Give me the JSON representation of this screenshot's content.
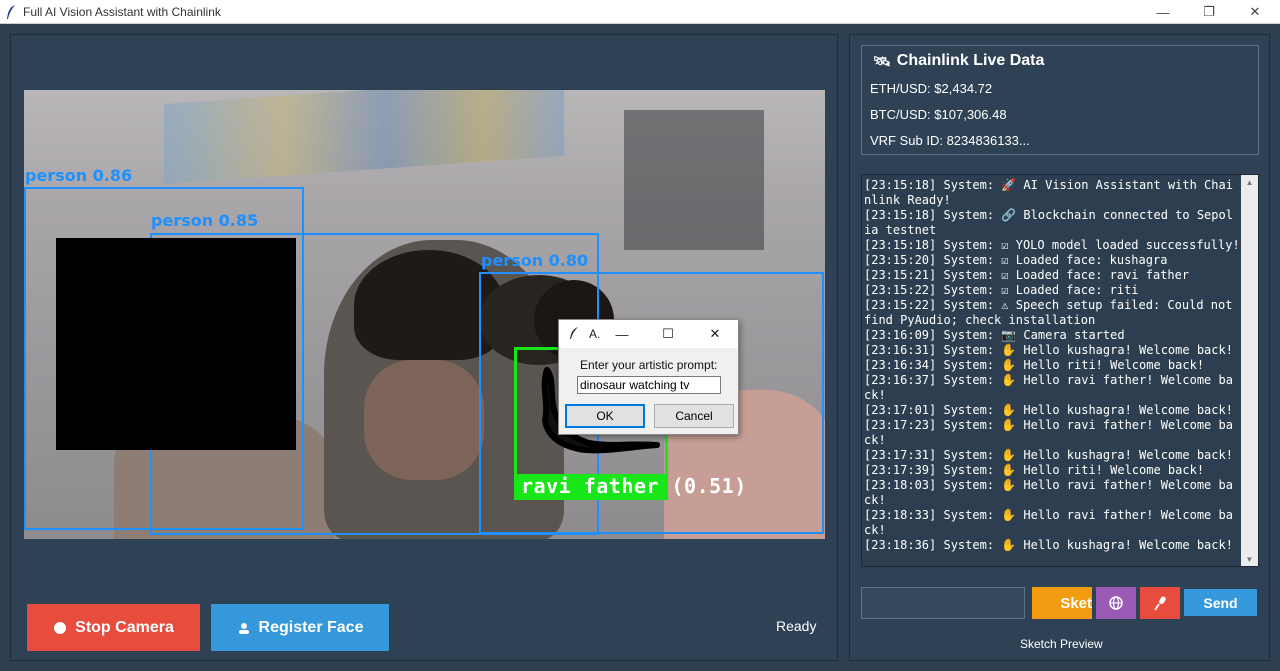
{
  "window": {
    "title": "Full AI Vision Assistant with Chainlink",
    "minimize": "—",
    "maximize": "❐",
    "close": "✕"
  },
  "video": {
    "detections": [
      {
        "label": "person 0.86"
      },
      {
        "label": "person 0.85"
      },
      {
        "label": "person 0.80"
      }
    ],
    "face_label": "ravi father (0.51)"
  },
  "dialog": {
    "title": "A.",
    "minimize": "—",
    "maximize": "☐",
    "close": "✕",
    "prompt_label": "Enter your artistic prompt:",
    "input_value": "dinosaur watching tv",
    "ok_label": "OK",
    "cancel_label": "Cancel"
  },
  "controls": {
    "stop_camera_label": "Stop Camera",
    "register_face_label": "Register Face",
    "status": "Ready"
  },
  "chainlink": {
    "title": "Chainlink Live Data",
    "eth_usd": "ETH/USD: $2,434.72",
    "btc_usd": "BTC/USD: $107,306.48",
    "vrf_sub": "VRF Sub ID: 8234836133..."
  },
  "log": {
    "text": "[23:15:18] System: 🚀 AI Vision Assistant with Chainlink Ready!\n[23:15:18] System: 🔗 Blockchain connected to Sepolia testnet\n[23:15:18] System: ☑ YOLO model loaded successfully!\n[23:15:20] System: ☑ Loaded face: kushagra\n[23:15:21] System: ☑ Loaded face: ravi father\n[23:15:22] System: ☑ Loaded face: riti\n[23:15:22] System: ⚠ Speech setup failed: Could not find PyAudio; check installation\n[23:16:09] System: 📷 Camera started\n[23:16:31] System: ✋ Hello kushagra! Welcome back!\n[23:16:34] System: ✋ Hello riti! Welcome back!\n[23:16:37] System: ✋ Hello ravi father! Welcome back!\n[23:17:01] System: ✋ Hello kushagra! Welcome back!\n[23:17:23] System: ✋ Hello ravi father! Welcome back!\n[23:17:31] System: ✋ Hello kushagra! Welcome back!\n[23:17:39] System: ✋ Hello riti! Welcome back!\n[23:18:03] System: ✋ Hello ravi father! Welcome back!\n[23:18:33] System: ✋ Hello ravi father! Welcome back!\n[23:18:36] System: ✋ Hello kushagra! Welcome back!"
  },
  "chat": {
    "input_value": "",
    "sketch_label": "Sket",
    "send_label": "Send",
    "sketch_preview_label": "Sketch Preview"
  },
  "colors": {
    "background": "#2c3e50",
    "stop": "#e74c3c",
    "register": "#3498db",
    "sketch": "#f39c12",
    "ar": "#9b59b6",
    "detection": "#1e90ff",
    "face": "#19e619"
  }
}
